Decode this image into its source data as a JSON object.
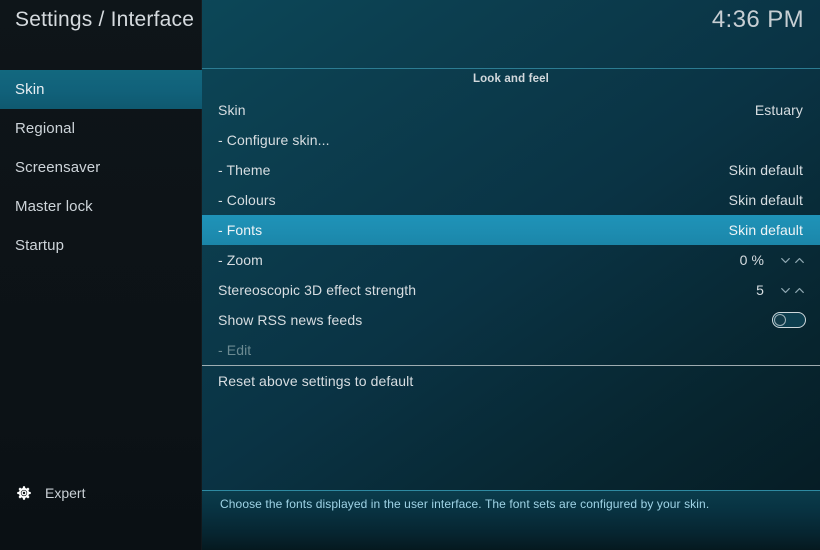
{
  "header": {
    "title": "Settings / Interface",
    "clock": "4:36 PM"
  },
  "sidebar": {
    "items": [
      {
        "label": "Skin",
        "selected": true
      },
      {
        "label": "Regional",
        "selected": false
      },
      {
        "label": "Screensaver",
        "selected": false
      },
      {
        "label": "Master lock",
        "selected": false
      },
      {
        "label": "Startup",
        "selected": false
      }
    ],
    "footer": {
      "icon": "gear-icon",
      "label": "Expert"
    }
  },
  "main": {
    "section_title": "Look and feel",
    "rows": [
      {
        "label": "Skin",
        "value": "Estuary",
        "control": "none",
        "highlight": false,
        "disabled": false
      },
      {
        "label": "- Configure skin...",
        "value": "",
        "control": "none",
        "highlight": false,
        "disabled": false
      },
      {
        "label": "- Theme",
        "value": "Skin default",
        "control": "none",
        "highlight": false,
        "disabled": false
      },
      {
        "label": "- Colours",
        "value": "Skin default",
        "control": "none",
        "highlight": false,
        "disabled": false
      },
      {
        "label": "- Fonts",
        "value": "Skin default",
        "control": "none",
        "highlight": true,
        "disabled": false
      },
      {
        "label": "- Zoom",
        "value": "0 %",
        "control": "spinner",
        "highlight": false,
        "disabled": false
      },
      {
        "label": "Stereoscopic 3D effect strength",
        "value": "5",
        "control": "spinner",
        "highlight": false,
        "disabled": false
      },
      {
        "label": "Show RSS news feeds",
        "value": "",
        "control": "toggle",
        "toggle_state": "off",
        "highlight": false,
        "disabled": false
      },
      {
        "label": "- Edit",
        "value": "",
        "control": "none",
        "highlight": false,
        "disabled": true
      },
      {
        "label": "Reset above settings to default",
        "value": "",
        "control": "none",
        "highlight": false,
        "disabled": false
      }
    ],
    "divider_after_index": 8
  },
  "help": {
    "text": "Choose the fonts displayed in the user interface. The font sets are configured by your skin."
  },
  "colors": {
    "highlight": "#1f93b8",
    "sidebar_selected": "#12687f",
    "accent_rule": "#2e8aa2",
    "help_text": "#9fd3e6"
  }
}
